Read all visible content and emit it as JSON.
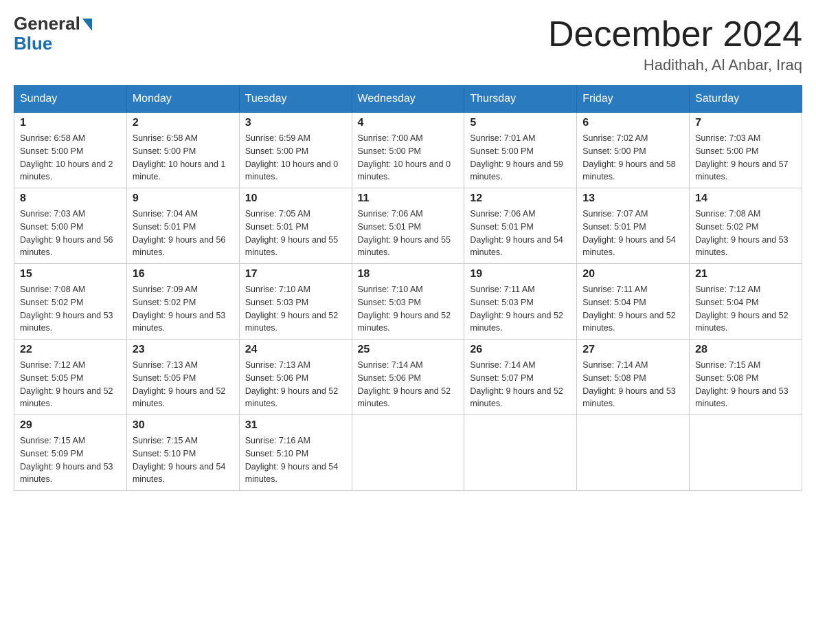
{
  "header": {
    "logo_general": "General",
    "logo_blue": "Blue",
    "month_title": "December 2024",
    "location": "Hadithah, Al Anbar, Iraq"
  },
  "weekdays": [
    "Sunday",
    "Monday",
    "Tuesday",
    "Wednesday",
    "Thursday",
    "Friday",
    "Saturday"
  ],
  "weeks": [
    [
      {
        "day": "1",
        "sunrise": "6:58 AM",
        "sunset": "5:00 PM",
        "daylight": "10 hours and 2 minutes."
      },
      {
        "day": "2",
        "sunrise": "6:58 AM",
        "sunset": "5:00 PM",
        "daylight": "10 hours and 1 minute."
      },
      {
        "day": "3",
        "sunrise": "6:59 AM",
        "sunset": "5:00 PM",
        "daylight": "10 hours and 0 minutes."
      },
      {
        "day": "4",
        "sunrise": "7:00 AM",
        "sunset": "5:00 PM",
        "daylight": "10 hours and 0 minutes."
      },
      {
        "day": "5",
        "sunrise": "7:01 AM",
        "sunset": "5:00 PM",
        "daylight": "9 hours and 59 minutes."
      },
      {
        "day": "6",
        "sunrise": "7:02 AM",
        "sunset": "5:00 PM",
        "daylight": "9 hours and 58 minutes."
      },
      {
        "day": "7",
        "sunrise": "7:03 AM",
        "sunset": "5:00 PM",
        "daylight": "9 hours and 57 minutes."
      }
    ],
    [
      {
        "day": "8",
        "sunrise": "7:03 AM",
        "sunset": "5:00 PM",
        "daylight": "9 hours and 56 minutes."
      },
      {
        "day": "9",
        "sunrise": "7:04 AM",
        "sunset": "5:01 PM",
        "daylight": "9 hours and 56 minutes."
      },
      {
        "day": "10",
        "sunrise": "7:05 AM",
        "sunset": "5:01 PM",
        "daylight": "9 hours and 55 minutes."
      },
      {
        "day": "11",
        "sunrise": "7:06 AM",
        "sunset": "5:01 PM",
        "daylight": "9 hours and 55 minutes."
      },
      {
        "day": "12",
        "sunrise": "7:06 AM",
        "sunset": "5:01 PM",
        "daylight": "9 hours and 54 minutes."
      },
      {
        "day": "13",
        "sunrise": "7:07 AM",
        "sunset": "5:01 PM",
        "daylight": "9 hours and 54 minutes."
      },
      {
        "day": "14",
        "sunrise": "7:08 AM",
        "sunset": "5:02 PM",
        "daylight": "9 hours and 53 minutes."
      }
    ],
    [
      {
        "day": "15",
        "sunrise": "7:08 AM",
        "sunset": "5:02 PM",
        "daylight": "9 hours and 53 minutes."
      },
      {
        "day": "16",
        "sunrise": "7:09 AM",
        "sunset": "5:02 PM",
        "daylight": "9 hours and 53 minutes."
      },
      {
        "day": "17",
        "sunrise": "7:10 AM",
        "sunset": "5:03 PM",
        "daylight": "9 hours and 52 minutes."
      },
      {
        "day": "18",
        "sunrise": "7:10 AM",
        "sunset": "5:03 PM",
        "daylight": "9 hours and 52 minutes."
      },
      {
        "day": "19",
        "sunrise": "7:11 AM",
        "sunset": "5:03 PM",
        "daylight": "9 hours and 52 minutes."
      },
      {
        "day": "20",
        "sunrise": "7:11 AM",
        "sunset": "5:04 PM",
        "daylight": "9 hours and 52 minutes."
      },
      {
        "day": "21",
        "sunrise": "7:12 AM",
        "sunset": "5:04 PM",
        "daylight": "9 hours and 52 minutes."
      }
    ],
    [
      {
        "day": "22",
        "sunrise": "7:12 AM",
        "sunset": "5:05 PM",
        "daylight": "9 hours and 52 minutes."
      },
      {
        "day": "23",
        "sunrise": "7:13 AM",
        "sunset": "5:05 PM",
        "daylight": "9 hours and 52 minutes."
      },
      {
        "day": "24",
        "sunrise": "7:13 AM",
        "sunset": "5:06 PM",
        "daylight": "9 hours and 52 minutes."
      },
      {
        "day": "25",
        "sunrise": "7:14 AM",
        "sunset": "5:06 PM",
        "daylight": "9 hours and 52 minutes."
      },
      {
        "day": "26",
        "sunrise": "7:14 AM",
        "sunset": "5:07 PM",
        "daylight": "9 hours and 52 minutes."
      },
      {
        "day": "27",
        "sunrise": "7:14 AM",
        "sunset": "5:08 PM",
        "daylight": "9 hours and 53 minutes."
      },
      {
        "day": "28",
        "sunrise": "7:15 AM",
        "sunset": "5:08 PM",
        "daylight": "9 hours and 53 minutes."
      }
    ],
    [
      {
        "day": "29",
        "sunrise": "7:15 AM",
        "sunset": "5:09 PM",
        "daylight": "9 hours and 53 minutes."
      },
      {
        "day": "30",
        "sunrise": "7:15 AM",
        "sunset": "5:10 PM",
        "daylight": "9 hours and 54 minutes."
      },
      {
        "day": "31",
        "sunrise": "7:16 AM",
        "sunset": "5:10 PM",
        "daylight": "9 hours and 54 minutes."
      },
      null,
      null,
      null,
      null
    ]
  ],
  "labels": {
    "sunrise": "Sunrise:",
    "sunset": "Sunset:",
    "daylight": "Daylight:"
  }
}
